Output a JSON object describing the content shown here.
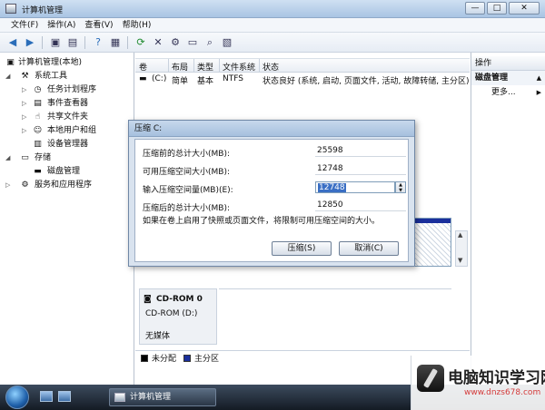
{
  "window": {
    "title": "计算机管理",
    "min_label": "—",
    "max_label": "□",
    "close_label": "✕"
  },
  "menu": [
    "文件(F)",
    "操作(A)",
    "查看(V)",
    "帮助(H)"
  ],
  "toolbar_icons": [
    "back-icon",
    "forward-icon",
    "up-icon",
    "show-tree-icon",
    "help-icon",
    "properties-icon",
    "refresh-icon",
    "delete-icon",
    "settings-icon",
    "open-icon",
    "search-icon",
    "export-icon"
  ],
  "tree": {
    "root": "计算机管理(本地)",
    "items": [
      {
        "label": "系统工具",
        "level": 1
      },
      {
        "label": "任务计划程序",
        "level": 2
      },
      {
        "label": "事件查看器",
        "level": 2
      },
      {
        "label": "共享文件夹",
        "level": 2
      },
      {
        "label": "本地用户和组",
        "level": 2
      },
      {
        "label": "设备管理器",
        "level": 2
      },
      {
        "label": "存储",
        "level": 1
      },
      {
        "label": "磁盘管理",
        "level": 2
      },
      {
        "label": "服务和应用程序",
        "level": 1
      }
    ]
  },
  "volume_table": {
    "headers": [
      "卷",
      "布局",
      "类型",
      "文件系统",
      "状态"
    ],
    "rows": [
      [
        "(C:)",
        "简单",
        "基本",
        "NTFS",
        "状态良好 (系统, 启动, 页面文件, 活动, 故障转储, 主分区)"
      ]
    ]
  },
  "disk": {
    "cdrom_name": "CD-ROM 0",
    "cdrom_drive": "CD-ROM (D:)",
    "cdrom_status": "无媒体"
  },
  "legend": [
    {
      "label": "未分配",
      "color": "#000000"
    },
    {
      "label": "主分区",
      "color": "#1a2f9c"
    }
  ],
  "actions": {
    "header": "操作",
    "section": "磁盘管理",
    "more": "更多..."
  },
  "dialog": {
    "title": "压缩 C:",
    "rows": [
      {
        "label": "压缩前的总计大小(MB):",
        "value": "25598"
      },
      {
        "label": "可用压缩空间大小(MB):",
        "value": "12748"
      },
      {
        "label": "输入压缩空间量(MB)(E):",
        "value": "12748"
      },
      {
        "label": "压缩后的总计大小(MB):",
        "value": "12850"
      }
    ],
    "note": "如果在卷上启用了快照或页面文件，将限制可用压缩空间的大小。",
    "compress_button": "压缩(S)",
    "cancel_button": "取消(C)"
  },
  "taskbar": {
    "task_label": "计算机管理"
  },
  "watermark": {
    "title": "电脑知识学习网",
    "url": "www.dnzs678.com"
  }
}
